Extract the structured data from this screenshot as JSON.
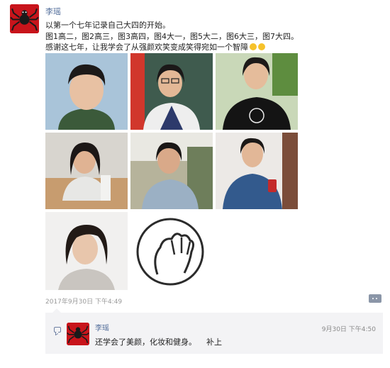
{
  "post": {
    "author": "李瑶",
    "text_line1": "以第一个七年记录自己大四的开始。",
    "text_line2": "图1高二，图2高三，图3高四，图4大一，图5大二，图6大三，图7大四。",
    "text_line3": "感谢这七年，让我学会了从强颜欢笑变成笑得宛如一个智障",
    "timestamp": "2017年9月30日 下午4:49"
  },
  "photos": [
    {
      "name": "photo-1",
      "subject": "id-photo"
    },
    {
      "name": "photo-2",
      "subject": "student-in-classroom"
    },
    {
      "name": "photo-3",
      "subject": "student-in-black-tshirt"
    },
    {
      "name": "photo-4",
      "subject": "student-at-table"
    },
    {
      "name": "photo-5",
      "subject": "student-outdoors"
    },
    {
      "name": "photo-6",
      "subject": "student-with-phone"
    },
    {
      "name": "photo-7",
      "subject": "portrait-short-hair"
    },
    {
      "name": "photo-8",
      "subject": "facepalm-sticker"
    }
  ],
  "comment": {
    "author": "李瑶",
    "time": "9月30日 下午4:50",
    "text": "还学会了美颜，化妆和健身。    补上"
  },
  "colors": {
    "name_link": "#4e6a98",
    "avatar_red": "#c8141b",
    "comment_bg": "#f3f3f5",
    "timestamp_gray": "#9a9a9a"
  },
  "icons": {
    "author_avatar": "spider-avatar-icon",
    "emoji": "grin-emoji-icon",
    "more": "more-dots-icon",
    "comment": "comment-bubble-icon"
  }
}
